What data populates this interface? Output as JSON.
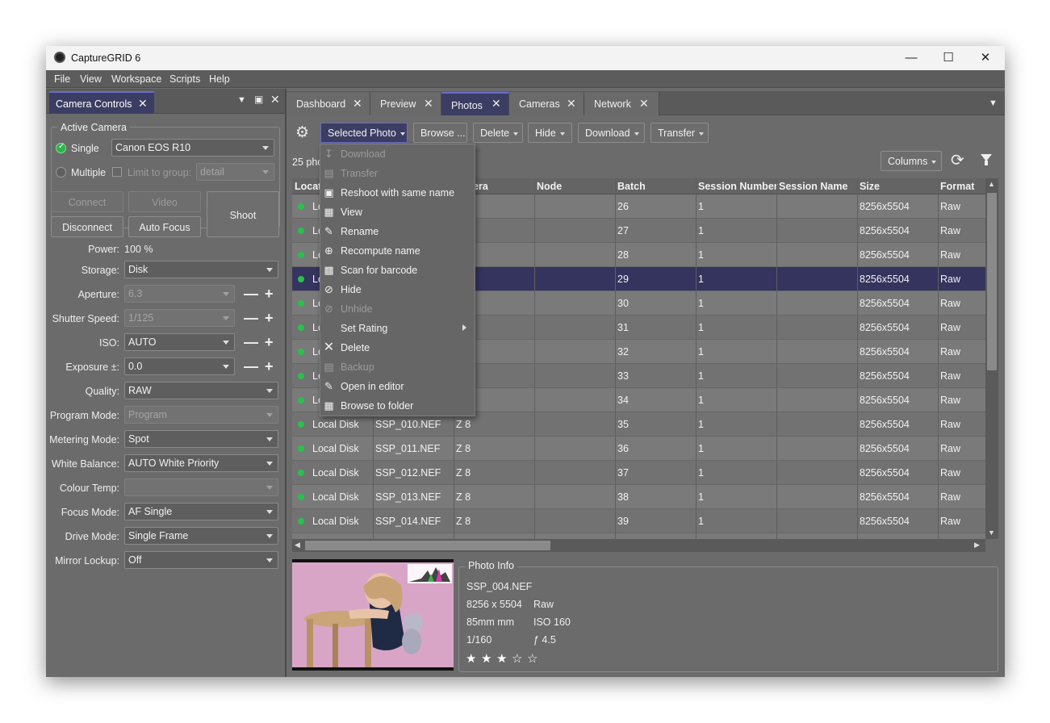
{
  "window": {
    "title": "CaptureGRID 6"
  },
  "menu": [
    "File",
    "View",
    "Workspace",
    "Scripts",
    "Help"
  ],
  "left_panel": {
    "tab_label": "Camera Controls",
    "active_camera_title": "Active Camera",
    "single_label": "Single",
    "camera_value": "Canon EOS R10",
    "multiple_label": "Multiple",
    "limit_label": "Limit to group:",
    "limit_value": "detail",
    "buttons": {
      "connect": "Connect",
      "video": "Video",
      "shoot": "Shoot",
      "disconnect": "Disconnect",
      "autofocus": "Auto Focus"
    },
    "power_label": "Power:",
    "power_value": "100 %",
    "fields": [
      {
        "label": "Storage:",
        "value": "Disk"
      },
      {
        "label": "Aperture:",
        "value": "6.3"
      },
      {
        "label": "Shutter Speed:",
        "value": "1/125"
      },
      {
        "label": "ISO:",
        "value": "AUTO"
      },
      {
        "label": "Exposure ±:",
        "value": "0.0"
      },
      {
        "label": "Quality:",
        "value": "RAW"
      },
      {
        "label": "Program Mode:",
        "value": "Program"
      },
      {
        "label": "Metering Mode:",
        "value": "Spot"
      },
      {
        "label": "White Balance:",
        "value": "AUTO White Priority"
      },
      {
        "label": "Colour Temp:",
        "value": ""
      },
      {
        "label": "Focus Mode:",
        "value": "AF Single"
      },
      {
        "label": "Drive Mode:",
        "value": "Single Frame"
      },
      {
        "label": "Mirror Lockup:",
        "value": "Off"
      }
    ]
  },
  "tabs": [
    "Dashboard",
    "Preview",
    "Photos",
    "Cameras",
    "Network"
  ],
  "toolbar": {
    "selected_photo": "Selected Photo",
    "browse": "Browse ...",
    "delete": "Delete",
    "hide": "Hide",
    "download": "Download",
    "transfer": "Transfer",
    "count": "25 pho",
    "columns": "Columns"
  },
  "context_menu": [
    {
      "label": "Download",
      "icon": "download-icon"
    },
    {
      "label": "Transfer",
      "icon": "transfer-icon"
    },
    {
      "label": "Reshoot with same name",
      "icon": "camera-icon"
    },
    {
      "label": "View",
      "icon": "view-icon"
    },
    {
      "label": "Rename",
      "icon": "rename-icon"
    },
    {
      "label": "Recompute name",
      "icon": "crosshair-icon"
    },
    {
      "label": "Scan for barcode",
      "icon": "qr-icon"
    },
    {
      "label": "Hide",
      "icon": "hide-icon"
    },
    {
      "label": "Unhide",
      "icon": "unhide-icon"
    },
    {
      "label": "Set Rating",
      "icon": ""
    },
    {
      "label": "Delete",
      "icon": "x-icon"
    },
    {
      "label": "Backup",
      "icon": "backup-icon"
    },
    {
      "label": "Open in editor",
      "icon": "editor-icon"
    },
    {
      "label": "Browse to folder",
      "icon": "folder-icon"
    }
  ],
  "table": {
    "columns": [
      "Locat",
      "",
      "era",
      "Node",
      "Batch",
      "Session Number",
      "Session Name",
      "Size",
      "Format"
    ],
    "rows": [
      {
        "loc": "Lo",
        "file": "",
        "camera": "",
        "node": "",
        "batch": "26",
        "sess": "1",
        "name": "",
        "size": "8256x5504",
        "fmt": "Raw"
      },
      {
        "loc": "Lo",
        "file": "",
        "camera": "",
        "node": "",
        "batch": "27",
        "sess": "1",
        "name": "",
        "size": "8256x5504",
        "fmt": "Raw"
      },
      {
        "loc": "Lo",
        "file": "",
        "camera": "",
        "node": "",
        "batch": "28",
        "sess": "1",
        "name": "",
        "size": "8256x5504",
        "fmt": "Raw"
      },
      {
        "loc": "Lo",
        "file": "",
        "camera": "",
        "node": "",
        "batch": "29",
        "sess": "1",
        "name": "",
        "size": "8256x5504",
        "fmt": "Raw"
      },
      {
        "loc": "Lo",
        "file": "",
        "camera": "",
        "node": "",
        "batch": "30",
        "sess": "1",
        "name": "",
        "size": "8256x5504",
        "fmt": "Raw"
      },
      {
        "loc": "Lo",
        "file": "",
        "camera": "",
        "node": "",
        "batch": "31",
        "sess": "1",
        "name": "",
        "size": "8256x5504",
        "fmt": "Raw"
      },
      {
        "loc": "Lo",
        "file": "",
        "camera": "",
        "node": "",
        "batch": "32",
        "sess": "1",
        "name": "",
        "size": "8256x5504",
        "fmt": "Raw"
      },
      {
        "loc": "Lo",
        "file": "",
        "camera": "",
        "node": "",
        "batch": "33",
        "sess": "1",
        "name": "",
        "size": "8256x5504",
        "fmt": "Raw"
      },
      {
        "loc": "Lo",
        "file": "",
        "camera": "",
        "node": "",
        "batch": "34",
        "sess": "1",
        "name": "",
        "size": "8256x5504",
        "fmt": "Raw"
      },
      {
        "loc": "Local Disk",
        "file": "SSP_010.NEF",
        "camera": "Z 8",
        "node": "",
        "batch": "35",
        "sess": "1",
        "name": "",
        "size": "8256x5504",
        "fmt": "Raw"
      },
      {
        "loc": "Local Disk",
        "file": "SSP_011.NEF",
        "camera": "Z 8",
        "node": "",
        "batch": "36",
        "sess": "1",
        "name": "",
        "size": "8256x5504",
        "fmt": "Raw"
      },
      {
        "loc": "Local Disk",
        "file": "SSP_012.NEF",
        "camera": "Z 8",
        "node": "",
        "batch": "37",
        "sess": "1",
        "name": "",
        "size": "8256x5504",
        "fmt": "Raw"
      },
      {
        "loc": "Local Disk",
        "file": "SSP_013.NEF",
        "camera": "Z 8",
        "node": "",
        "batch": "38",
        "sess": "1",
        "name": "",
        "size": "8256x5504",
        "fmt": "Raw"
      },
      {
        "loc": "Local Disk",
        "file": "SSP_014.NEF",
        "camera": "Z 8",
        "node": "",
        "batch": "39",
        "sess": "1",
        "name": "",
        "size": "8256x5504",
        "fmt": "Raw"
      }
    ]
  },
  "photo_info": {
    "title": "Photo Info",
    "filename": "SSP_004.NEF",
    "dimensions": "8256 x 5504",
    "format": "Raw",
    "focal": "85mm mm",
    "iso": "ISO 160",
    "shutter": "1/160",
    "aperture": "ƒ 4.5",
    "rating": 3,
    "rating_max": 5
  },
  "colors": {
    "accent": "#3c3d63",
    "selected_row": "#35345e",
    "status_green": "#27c24c"
  }
}
